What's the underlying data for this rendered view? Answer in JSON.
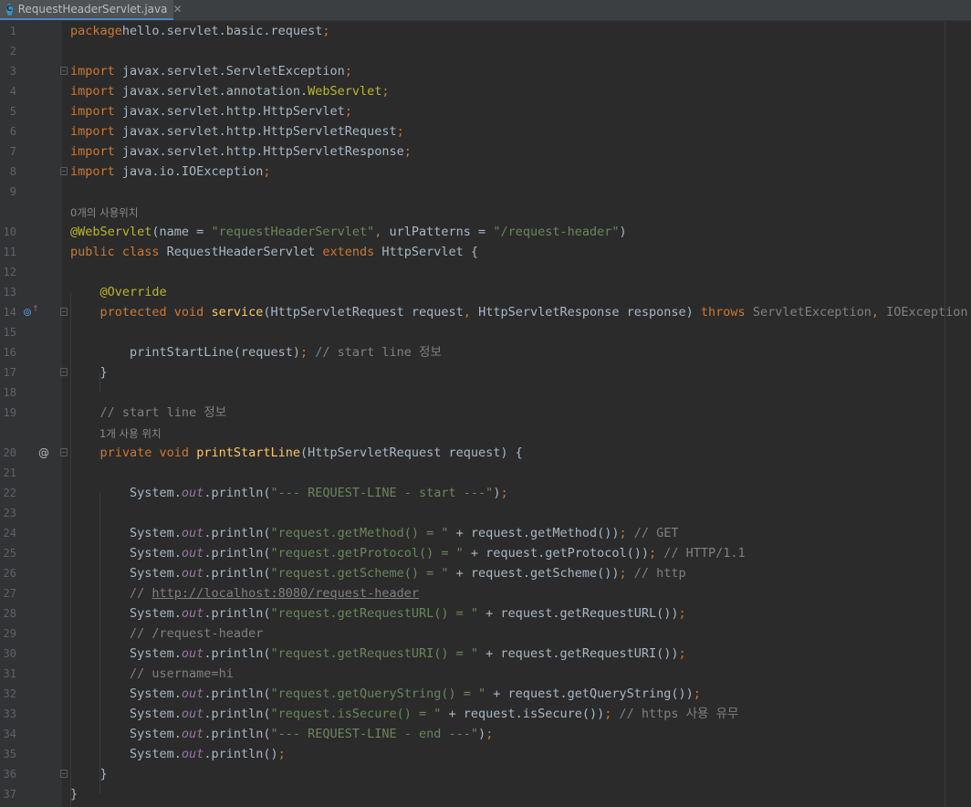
{
  "tab": {
    "icon_letter": "C",
    "filename": "RequestHeaderServlet.java",
    "close_glyph": "✕"
  },
  "colors": {
    "background": "#2b2b2b",
    "keyword": "#cc7832",
    "annotation": "#bbb529",
    "string": "#6a8759",
    "comment": "#808080",
    "method_declaration": "#ffc66d",
    "static_field": "#9876aa",
    "default_text": "#a9b7c6"
  },
  "usage_hints": {
    "class_hint": "0개의 사용위치",
    "method_hint": "1개 사용 위치"
  },
  "gutter_icons": {
    "line14": "override-method-icon",
    "line20": "at-sign-icon"
  },
  "lines": [
    {
      "n": "1",
      "parts": [
        [
          "kw",
          "package"
        ],
        [
          "",
          "hello.servlet.basic.request"
        ],
        [
          "kw",
          ";"
        ]
      ]
    },
    {
      "n": "2",
      "parts": []
    },
    {
      "n": "3",
      "parts": [
        [
          "kw",
          "import"
        ],
        [
          "",
          " javax.servlet.ServletException"
        ],
        [
          "kw",
          ";"
        ]
      ]
    },
    {
      "n": "4",
      "parts": [
        [
          "kw",
          "import"
        ],
        [
          "",
          " javax.servlet.annotation."
        ],
        [
          "ann",
          "WebServlet"
        ],
        [
          "kw",
          ";"
        ]
      ]
    },
    {
      "n": "5",
      "parts": [
        [
          "kw",
          "import"
        ],
        [
          "",
          " javax.servlet.http.HttpServlet"
        ],
        [
          "kw",
          ";"
        ]
      ]
    },
    {
      "n": "6",
      "parts": [
        [
          "kw",
          "import"
        ],
        [
          "",
          " javax.servlet.http.HttpServletRequest"
        ],
        [
          "kw",
          ";"
        ]
      ]
    },
    {
      "n": "7",
      "parts": [
        [
          "kw",
          "import"
        ],
        [
          "",
          " javax.servlet.http.HttpServletResponse"
        ],
        [
          "kw",
          ";"
        ]
      ]
    },
    {
      "n": "8",
      "parts": [
        [
          "kw",
          "import"
        ],
        [
          "",
          " java.io.IOException"
        ],
        [
          "kw",
          ";"
        ]
      ]
    },
    {
      "n": "9",
      "parts": []
    },
    {
      "n": "10",
      "parts": [
        [
          "ann",
          "@WebServlet"
        ],
        [
          "",
          "(name = "
        ],
        [
          "str",
          "\"requestHeaderServlet\""
        ],
        [
          "kw",
          ", "
        ],
        [
          "",
          "urlPatterns = "
        ],
        [
          "str",
          "\"/request-header\""
        ],
        [
          "",
          ")"
        ]
      ]
    },
    {
      "n": "11",
      "parts": [
        [
          "kw",
          "public class "
        ],
        [
          "",
          "RequestHeaderServlet "
        ],
        [
          "kw",
          "extends "
        ],
        [
          "",
          "HttpServlet {"
        ]
      ]
    },
    {
      "n": "12",
      "parts": []
    },
    {
      "n": "13",
      "parts": [
        [
          "",
          "    "
        ],
        [
          "ann",
          "@Override"
        ]
      ]
    },
    {
      "n": "14",
      "parts": [
        [
          "",
          "    "
        ],
        [
          "kw",
          "protected void "
        ],
        [
          "fn",
          "service"
        ],
        [
          "",
          "(HttpServletRequest request"
        ],
        [
          "kw",
          ", "
        ],
        [
          "",
          "HttpServletResponse response) "
        ],
        [
          "kw",
          "throws "
        ],
        [
          "dim",
          "ServletException"
        ],
        [
          "kw",
          ", "
        ],
        [
          "dim",
          "IOException"
        ],
        [
          "",
          " {"
        ]
      ]
    },
    {
      "n": "15",
      "parts": []
    },
    {
      "n": "16",
      "parts": [
        [
          "",
          "        printStartLine(request)"
        ],
        [
          "kw",
          "; "
        ],
        [
          "cmt",
          "// start line 정보"
        ]
      ]
    },
    {
      "n": "17",
      "parts": [
        [
          "",
          "    }"
        ]
      ]
    },
    {
      "n": "18",
      "parts": []
    },
    {
      "n": "19",
      "parts": [
        [
          "",
          "    "
        ],
        [
          "cmt",
          "// start line 정보"
        ]
      ]
    },
    {
      "n": "20",
      "parts": [
        [
          "",
          "    "
        ],
        [
          "kw",
          "private void "
        ],
        [
          "fn",
          "printStartLine"
        ],
        [
          "",
          "(HttpServletRequest request) {"
        ]
      ]
    },
    {
      "n": "21",
      "parts": []
    },
    {
      "n": "22",
      "parts": [
        [
          "",
          "        System."
        ],
        [
          "fld",
          "out"
        ],
        [
          "",
          ".println("
        ],
        [
          "str",
          "\"--- REQUEST-LINE - start ---\""
        ],
        [
          "",
          ")"
        ],
        [
          "kw",
          ";"
        ]
      ]
    },
    {
      "n": "23",
      "parts": []
    },
    {
      "n": "24",
      "parts": [
        [
          "",
          "        System."
        ],
        [
          "fld",
          "out"
        ],
        [
          "",
          ".println("
        ],
        [
          "str",
          "\"request.getMethod() = \""
        ],
        [
          "",
          " + request.getMethod())"
        ],
        [
          "kw",
          "; "
        ],
        [
          "cmt",
          "// GET"
        ]
      ]
    },
    {
      "n": "25",
      "parts": [
        [
          "",
          "        System."
        ],
        [
          "fld",
          "out"
        ],
        [
          "",
          ".println("
        ],
        [
          "str",
          "\"request.getProtocol() = \""
        ],
        [
          "",
          " + request.getProtocol())"
        ],
        [
          "kw",
          "; "
        ],
        [
          "cmt",
          "// HTTP/1.1"
        ]
      ]
    },
    {
      "n": "26",
      "parts": [
        [
          "",
          "        System."
        ],
        [
          "fld",
          "out"
        ],
        [
          "",
          ".println("
        ],
        [
          "str",
          "\"request.getScheme() = \""
        ],
        [
          "",
          " + request.getScheme())"
        ],
        [
          "kw",
          "; "
        ],
        [
          "cmt",
          "// http"
        ]
      ]
    },
    {
      "n": "27",
      "parts": [
        [
          "",
          "        "
        ],
        [
          "cmt",
          "// "
        ],
        [
          "link",
          "http://localhost:8080/request-header"
        ]
      ]
    },
    {
      "n": "28",
      "parts": [
        [
          "",
          "        System."
        ],
        [
          "fld",
          "out"
        ],
        [
          "",
          ".println("
        ],
        [
          "str",
          "\"request.getRequestURL() = \""
        ],
        [
          "",
          " + request.getRequestURL())"
        ],
        [
          "kw",
          ";"
        ]
      ]
    },
    {
      "n": "29",
      "parts": [
        [
          "",
          "        "
        ],
        [
          "cmt",
          "// /request-header"
        ]
      ]
    },
    {
      "n": "30",
      "parts": [
        [
          "",
          "        System."
        ],
        [
          "fld",
          "out"
        ],
        [
          "",
          ".println("
        ],
        [
          "str",
          "\"request.getRequestURI() = \""
        ],
        [
          "",
          " + request.getRequestURI())"
        ],
        [
          "kw",
          ";"
        ]
      ]
    },
    {
      "n": "31",
      "parts": [
        [
          "",
          "        "
        ],
        [
          "cmt",
          "// username=hi"
        ]
      ]
    },
    {
      "n": "32",
      "parts": [
        [
          "",
          "        System."
        ],
        [
          "fld",
          "out"
        ],
        [
          "",
          ".println("
        ],
        [
          "str",
          "\"request.getQueryString() = \""
        ],
        [
          "",
          " + request.getQueryString())"
        ],
        [
          "kw",
          ";"
        ]
      ]
    },
    {
      "n": "33",
      "parts": [
        [
          "",
          "        System."
        ],
        [
          "fld",
          "out"
        ],
        [
          "",
          ".println("
        ],
        [
          "str",
          "\"request.isSecure() = \""
        ],
        [
          "",
          " + request.isSecure())"
        ],
        [
          "kw",
          "; "
        ],
        [
          "cmt",
          "// https 사용 유무"
        ]
      ]
    },
    {
      "n": "34",
      "parts": [
        [
          "",
          "        System."
        ],
        [
          "fld",
          "out"
        ],
        [
          "",
          ".println("
        ],
        [
          "str",
          "\"--- REQUEST-LINE - end ---\""
        ],
        [
          "",
          ")"
        ],
        [
          "kw",
          ";"
        ]
      ]
    },
    {
      "n": "35",
      "parts": [
        [
          "",
          "        System."
        ],
        [
          "fld",
          "out"
        ],
        [
          "",
          ".println()"
        ],
        [
          "kw",
          ";"
        ]
      ]
    },
    {
      "n": "36",
      "parts": [
        [
          "",
          "    }"
        ]
      ]
    },
    {
      "n": "37",
      "parts": [
        [
          "",
          "}"
        ]
      ]
    }
  ]
}
